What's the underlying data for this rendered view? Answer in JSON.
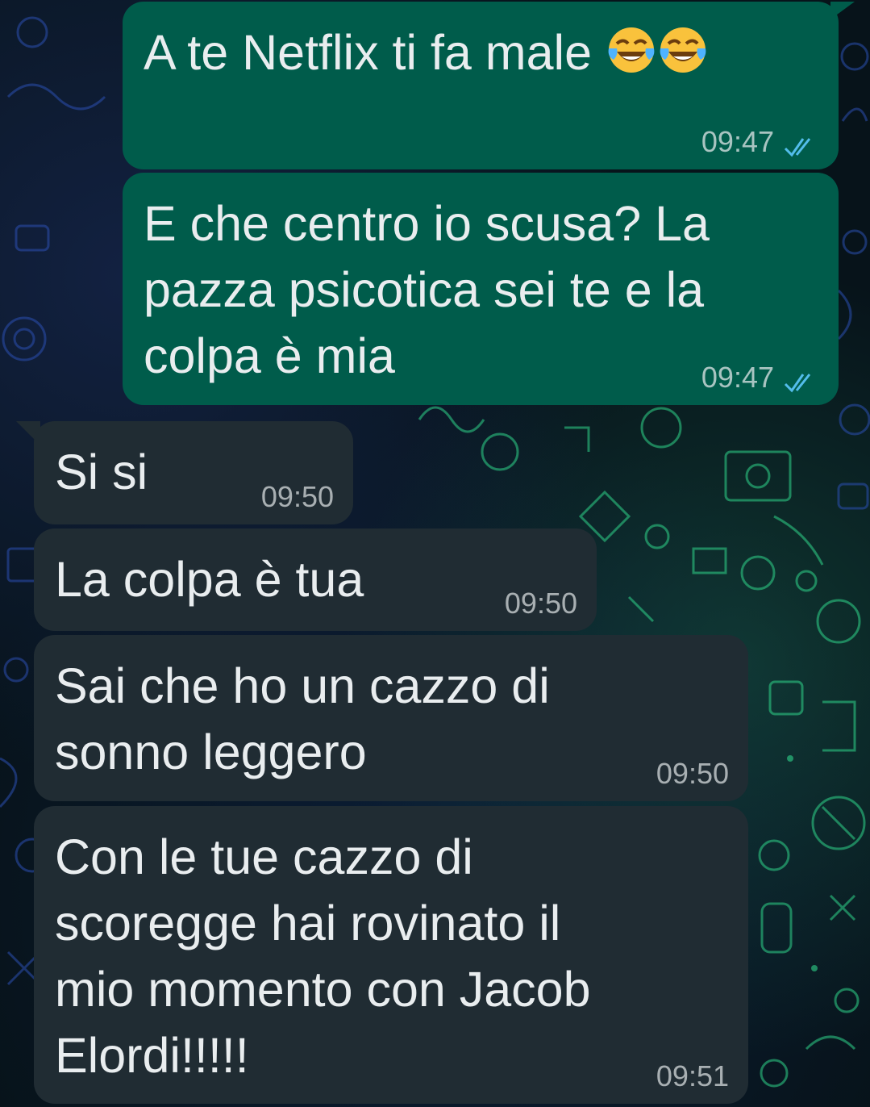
{
  "conversation": {
    "messages": [
      {
        "direction": "outgoing",
        "text": "A te Netflix ti fa male",
        "emoji": [
          "face-with-tears-of-joy",
          "face-with-tears-of-joy"
        ],
        "time": "09:47",
        "status": "read"
      },
      {
        "direction": "outgoing",
        "text": "E che centro io scusa? La\npazza psicotica sei te e la\ncolpa è mia",
        "time": "09:47",
        "status": "read"
      },
      {
        "direction": "incoming",
        "text": "Si si",
        "time": "09:50"
      },
      {
        "direction": "incoming",
        "text": "La colpa è tua",
        "time": "09:50"
      },
      {
        "direction": "incoming",
        "text": "Sai che ho un cazzo di\nsonno leggero",
        "time": "09:50"
      },
      {
        "direction": "incoming",
        "text": "Con le tue cazzo di\nscoregge hai rovinato il\nmio momento con Jacob\nElordi!!!!!",
        "time": "09:51"
      }
    ]
  },
  "colors": {
    "outgoing_bubble": "#005c4b",
    "incoming_bubble": "#202c33",
    "read_ticks": "#53bdeb",
    "background": "#0b141a"
  }
}
